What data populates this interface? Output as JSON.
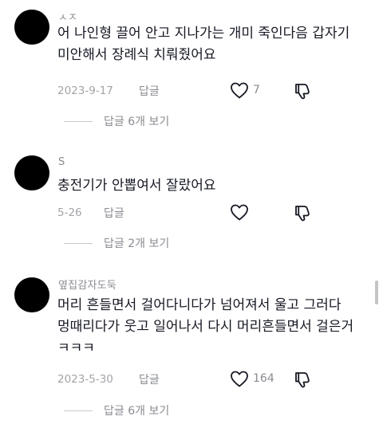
{
  "comments": [
    {
      "username": "ㅅㅈ",
      "text": "어 나인형 끌어 안고 지나가는 개미 죽인다음 갑자기\n미안해서 장례식 치뤄줬어요",
      "date": "2023-9-17",
      "reply_label": "답글",
      "likes": "7",
      "view_replies": "답글 6개 보기"
    },
    {
      "username": "S",
      "text": "충전기가 안뽑여서 잘랐어요",
      "date": "5-26",
      "reply_label": "답글",
      "likes": "",
      "view_replies": "답글 2개 보기"
    },
    {
      "username": "옆집감자도둑",
      "text": "머리 흔들면서 걸어다니다가 넘어져서 울고 그러다\n멍때리다가 웃고 일어나서 다시 머리흔들면서 걸은거\nㅋㅋㅋ",
      "date": "2023-5-30",
      "reply_label": "답글",
      "likes": "164",
      "view_replies": "답글 6개 보기"
    }
  ],
  "icons": {
    "like": "heart-outline-icon",
    "dislike": "thumbs-down-outline-icon"
  },
  "colors": {
    "text": "#161823",
    "muted": "#8a8b91",
    "avatar": "#000000"
  }
}
